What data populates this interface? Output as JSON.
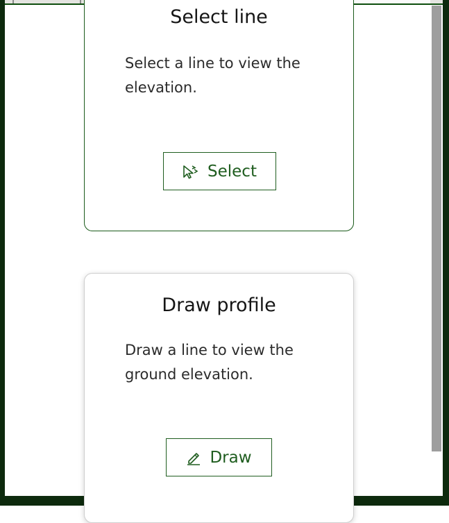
{
  "colors": {
    "accent": "#1f5d1f",
    "frame": "#0d2a0d",
    "text": "#151515"
  },
  "cards": [
    {
      "title": "Select line",
      "description": "Select a line to view the elevation.",
      "button_label": "Select",
      "button_icon": "cursor-select-icon",
      "state": "selected"
    },
    {
      "title": "Draw profile",
      "description": "Draw a line to view the ground elevation.",
      "button_label": "Draw",
      "button_icon": "pencil-icon",
      "state": "default"
    }
  ]
}
